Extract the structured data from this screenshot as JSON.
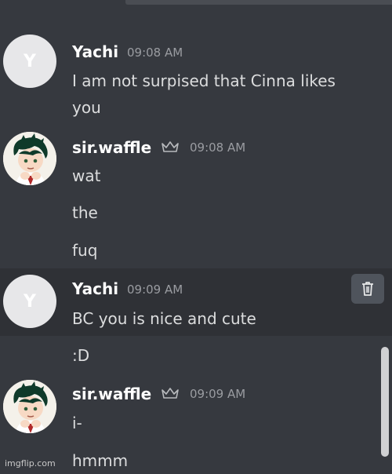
{
  "messages": [
    {
      "author": "Yachi",
      "avatar_letter": "Y",
      "time": "09:08 AM",
      "lines": [
        "I am not surpised that Cinna likes",
        "you"
      ]
    },
    {
      "author": "sir.waffle",
      "badge_icon": "crown-icon",
      "time": "09:08 AM",
      "lines": [
        "wat",
        "the",
        "fuq"
      ]
    },
    {
      "author": "Yachi",
      "avatar_letter": "Y",
      "time": "09:09 AM",
      "lines": [
        "BC you is nice and cute",
        ":D"
      ],
      "action_icon": "trash-icon"
    },
    {
      "author": "sir.waffle",
      "badge_icon": "crown-icon",
      "time": "09:09 AM",
      "lines": [
        "i-",
        "hmmm"
      ]
    }
  ],
  "watermark": "imgflip.com",
  "colors": {
    "background": "#36393f",
    "highlight": "#2f3136",
    "username": "#ffffff",
    "timestamp": "#9a9ca1",
    "message_text": "#dcddde"
  }
}
